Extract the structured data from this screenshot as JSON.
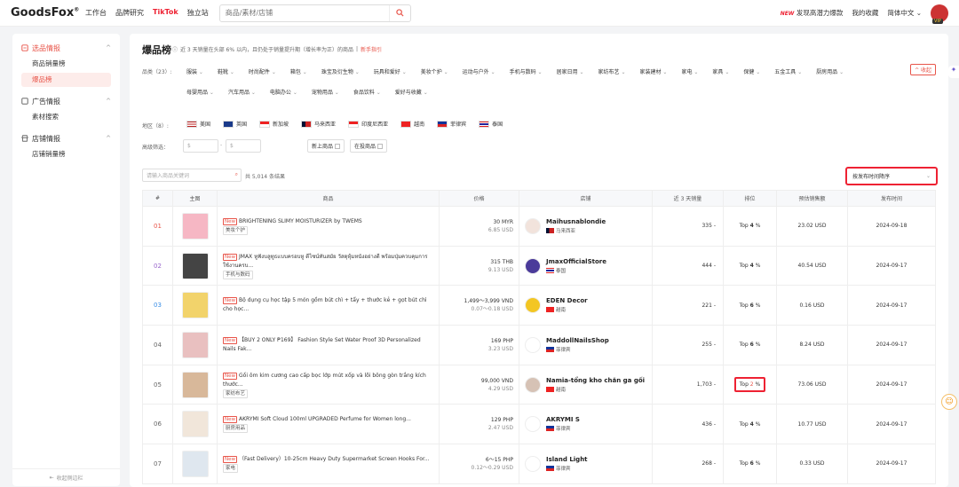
{
  "header": {
    "logo": "GoodsFox",
    "nav": [
      "工作台",
      "品牌研究",
      "TikTok",
      "独立站"
    ],
    "search_placeholder": "商品/素材/店铺",
    "new_badge": "NEW",
    "promo": "发现高潜力爆款",
    "favorites": "我的收藏",
    "language": "简体中文 ⌄",
    "vip": "VIP"
  },
  "sidebar": {
    "groups": [
      {
        "title": "选品情报",
        "items": [
          "商品销量榜",
          "爆品榜"
        ]
      },
      {
        "title": "广告情报",
        "items": [
          "素材搜索"
        ]
      },
      {
        "title": "店铺情报",
        "items": [
          "店铺销量榜"
        ]
      }
    ],
    "footer": "收起侧边栏"
  },
  "page": {
    "title": "爆品榜",
    "note": "近 3 天销量在头部 6% 以内，且仍处于销量提升期（增长率为正）的商品",
    "guide": "新手指引",
    "cat_label": "品类（23）:",
    "categories": [
      "服装",
      "鞋靴",
      "时尚配件",
      "箱包",
      "珠宝及衍生物",
      "玩具和爱好",
      "美妆个护",
      "运动与户外",
      "手机与数码",
      "居家日用",
      "家纺布艺",
      "家装建材",
      "家电",
      "家具",
      "保健",
      "五金工具",
      "厨房用品",
      "母婴用品",
      "汽车用品",
      "电脑办公",
      "宠物用品",
      "食品饮料",
      "爱好与收藏"
    ],
    "fold": "^ 收起",
    "region_label": "地区（8）:",
    "regions": [
      "美国",
      "英国",
      "新加坡",
      "马来西亚",
      "印度尼西亚",
      "越南",
      "菲律宾",
      "泰国"
    ],
    "adv_label": "高级筛选：",
    "currency": "$",
    "range_sep": "-",
    "chk_new": "新上商品",
    "chk_active": "在投商品",
    "kw_placeholder": "请输入商品关键词",
    "total": "共 5,014 条结果",
    "sort": "按发布时间降序"
  },
  "table": {
    "headers": [
      "#",
      "主图",
      "商品",
      "价格",
      "店铺",
      "近 3 天销量",
      "排位",
      "预估销售额",
      "发布时间"
    ],
    "new_label": "New",
    "rows": [
      {
        "rank": "01",
        "title": "BRIGHTENING SLIMY MOISTURIZER by TWEMS",
        "tag": "美妆个护",
        "price": "30 MYR",
        "usd": "6.85 USD",
        "shop": "Maihusnablondie",
        "region": "马来西亚",
        "sales": "335 -",
        "pos_pre": "Top ",
        "pos_num": "4",
        "pos_suf": " %",
        "revenue": "23.02 USD",
        "date": "2024-09-18"
      },
      {
        "rank": "02",
        "title": "JMAX หูฟังบลูทูธแบบครอบหู ดีไซน์ทันสมัย วัสดุหุ้มหนังอย่างดี พร้อมปุ่มควบคุมการใช้งานครบ...",
        "tag": "手机与数码",
        "price": "315 THB",
        "usd": "9.13 USD",
        "shop": "JmaxOfficialStore",
        "region": "泰国",
        "sales": "444 -",
        "pos_pre": "Top ",
        "pos_num": "4",
        "pos_suf": " %",
        "revenue": "40.54 USD",
        "date": "2024-09-17"
      },
      {
        "rank": "03",
        "title": "Bộ dụng cụ học tập 5 món gồm bút chì + tẩy + thước kẻ + gọt bút chì cho học...",
        "tag": "",
        "price": "1,499～3,999 VND",
        "usd": "0.07～0.18 USD",
        "shop": "EDEN Decor",
        "region": "越南",
        "sales": "221 -",
        "pos_pre": "Top ",
        "pos_num": "6",
        "pos_suf": " %",
        "revenue": "0.16 USD",
        "date": "2024-09-17"
      },
      {
        "rank": "04",
        "title": "【BUY 2 ONLY ₱169】 Fashion Style Set Water Proof 3D Personalized Nails Fak...",
        "tag": "",
        "price": "169 PHP",
        "usd": "3.23 USD",
        "shop": "MaddollNailsShop",
        "region": "菲律宾",
        "sales": "255 -",
        "pos_pre": "Top ",
        "pos_num": "6",
        "pos_suf": " %",
        "revenue": "8.24 USD",
        "date": "2024-09-17"
      },
      {
        "rank": "05",
        "title": "Gối ôm kim cương cao cấp bọc lớp mút xốp và lõi bông gòn trắng kích thước...",
        "tag": "家纺布艺",
        "price": "99,000 VND",
        "usd": "4.29 USD",
        "shop": "Namia-tổng kho chăn ga gối",
        "region": "越南",
        "sales": "1,703 -",
        "pos_pre": "Top ",
        "pos_num": "2",
        "pos_suf": " %",
        "revenue": "73.06 USD",
        "date": "2024-09-17"
      },
      {
        "rank": "06",
        "title": "AKRYMI Soft Cloud 100ml UPGRADED Perfume for Women long...",
        "tag": "厨房用品",
        "price": "129 PHP",
        "usd": "2.47 USD",
        "shop": "AKRYMI S",
        "region": "菲律宾",
        "sales": "436 -",
        "pos_pre": "Top ",
        "pos_num": "4",
        "pos_suf": " %",
        "revenue": "10.77 USD",
        "date": "2024-09-17"
      },
      {
        "rank": "07",
        "title": "（Fast Delivery）10-25cm Heavy Duty Supermarket Screen Hooks For...",
        "tag": "家电",
        "price": "6～15 PHP",
        "usd": "0.12～0.29 USD",
        "shop": "Island Light",
        "region": "菲律宾",
        "sales": "268 -",
        "pos_pre": "Top ",
        "pos_num": "6",
        "pos_suf": " %",
        "revenue": "0.33 USD",
        "date": "2024-09-17"
      }
    ]
  },
  "colors": {
    "accent": "#e8554a",
    "highlight_border": "#e22233"
  }
}
